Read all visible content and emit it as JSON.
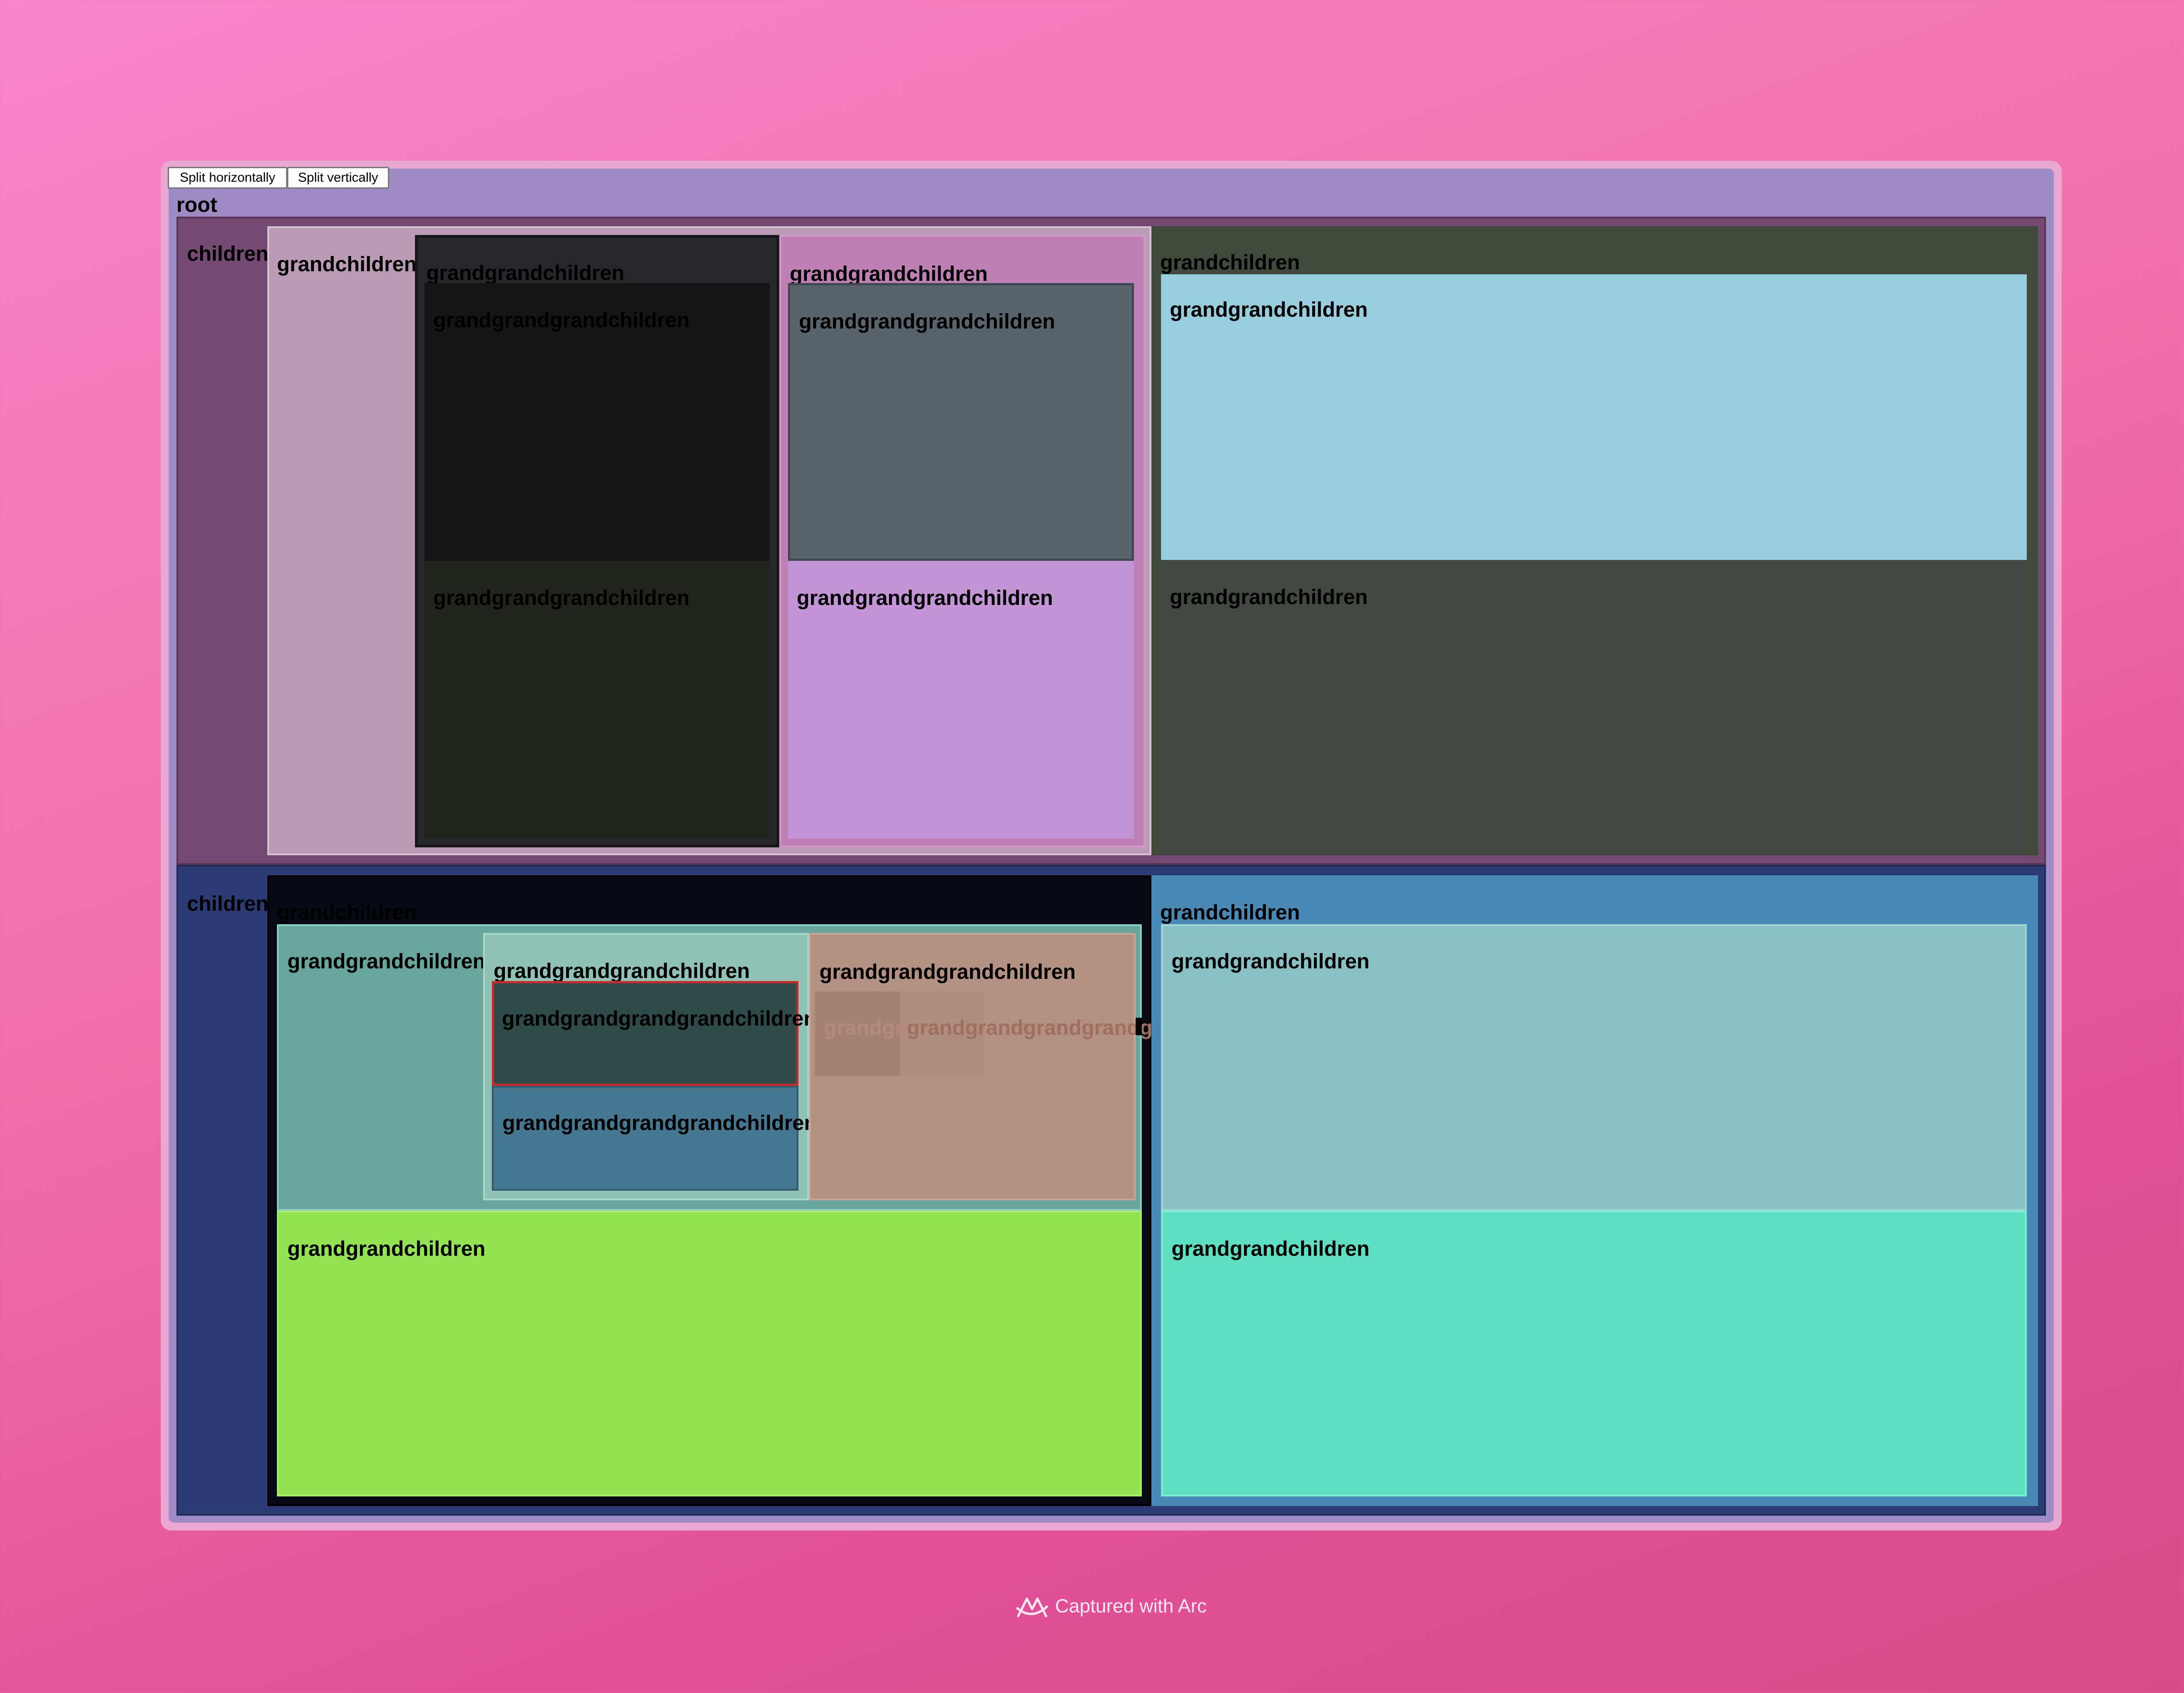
{
  "toolbar": {
    "split_horizontally_label": "Split horizontally",
    "split_vertically_label": "Split vertically"
  },
  "root": {
    "label": "root"
  },
  "top_child": {
    "label": "children",
    "grandchildren_a": {
      "label": "grandchildren",
      "ggc_dark": {
        "label": "grandgrandchildren",
        "gggc_top": "grandgrandgrandchildren",
        "gggc_bottom": "grandgrandgrandchildren"
      },
      "ggc_pink": {
        "label": "grandgrandchildren",
        "gggc_top": "grandgrandgrandchildren",
        "gggc_bottom": "grandgrandgrandchildren"
      }
    },
    "grandchildren_b": {
      "label": "grandchildren",
      "ggc_top": "grandgrandchildren",
      "ggc_bottom": "grandgrandchildren"
    }
  },
  "bottom_child": {
    "label": "children",
    "grandchildren_a": {
      "label": "grandchildren",
      "ggc_teal": {
        "label": "grandgrandchildren",
        "gggc_mint": {
          "label": "grandgrandgrandchildren",
          "ggggc_dark": "grandgrandgrandgrandchildren",
          "ggggc_blue": "grandgrandgrandgrandchildren"
        },
        "gggc_tan": {
          "label": "grandgrandgrandchildren",
          "overflow_text_1": "grandgrandgrandgrandchildren",
          "overflow_text_2": "grandgrandgrandgrandgrandchildren"
        }
      },
      "ggc_green": {
        "label": "grandgrandchildren"
      }
    },
    "grandchildren_b": {
      "label": "grandchildren",
      "ggc_top": "grandgrandchildren",
      "ggc_bottom": "grandgrandchildren"
    }
  },
  "footer": {
    "text": "Captured with Arc"
  },
  "colors": {
    "frame": "#9f8bc3",
    "top_child": "#744a72",
    "bottom_child": "#2b3a72",
    "highlight_border": "#cc2a2a"
  }
}
